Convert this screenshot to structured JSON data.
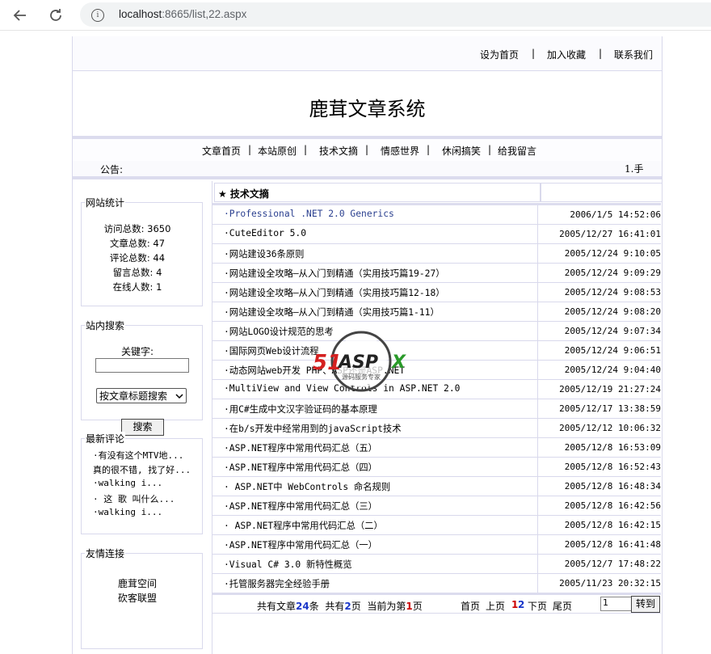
{
  "browser": {
    "url_host": "localhost",
    "url_rest": ":8665/list,22.aspx",
    "back_icon": "back-arrow-icon",
    "reload_icon": "reload-icon",
    "info_icon": "info-icon"
  },
  "toplinks": {
    "home": "设为首页",
    "fav": "加入收藏",
    "contact": "联系我们",
    "sep": "|"
  },
  "site_title": "鹿茸文章系统",
  "nav": {
    "items": [
      "文章首页",
      "本站原创",
      "技术文摘",
      "情感世界",
      "休闲搞笑",
      "给我留言"
    ],
    "sep": "|"
  },
  "notice": {
    "label": "公告:",
    "marquee": "1.手"
  },
  "sidebar": {
    "stats": {
      "title": "网站统计",
      "lines": [
        "访问总数: 3650",
        "文章总数: 47",
        "评论总数: 44",
        "留言总数: 4",
        "在线人数: 1"
      ]
    },
    "search": {
      "title": "站内搜索",
      "keyword_label": "关键字:",
      "keyword_value": "",
      "select_value": "按文章标题搜索",
      "button": "搜索"
    },
    "comments": {
      "title": "最新评论",
      "items": [
        "·有没有这个MTV地...",
        "真的很不错, 找了好...",
        "·walking i...",
        "· 这 歌 叫什么...",
        "·walking i..."
      ]
    },
    "links": {
      "title": "友情连接",
      "items": [
        "鹿茸空间",
        "砍客联盟"
      ]
    }
  },
  "content": {
    "category": "★ 技术文摘",
    "articles": [
      {
        "title": "·Professional .NET 2.0 Generics",
        "date": "2006/1/5 14:52:06"
      },
      {
        "title": "·CuteEditor 5.0",
        "date": "2005/12/27 16:41:01"
      },
      {
        "title": "·网站建设36条原则",
        "date": "2005/12/24 9:10:05"
      },
      {
        "title": "·网站建设全攻略—从入门到精通（实用技巧篇19-27）",
        "date": "2005/12/24 9:09:29"
      },
      {
        "title": "·网站建设全攻略—从入门到精通（实用技巧篇12-18）",
        "date": "2005/12/24 9:08:53"
      },
      {
        "title": "·网站建设全攻略—从入门到精通（实用技巧篇1-11）",
        "date": "2005/12/24 9:08:20"
      },
      {
        "title": "·网站LOGO设计规范的思考",
        "date": "2005/12/24 9:07:34"
      },
      {
        "title": "·国际网页Web设计流程",
        "date": "2005/12/24 9:06:51"
      },
      {
        "title": "·动态网站web开发 PHP、ASP还是ASP.NET",
        "date": "2005/12/24 9:04:40"
      },
      {
        "title": "·MultiView and View Controls in ASP.NET 2.0",
        "date": "2005/12/19 21:27:24"
      },
      {
        "title": "·用C#生成中文汉字验证码的基本原理",
        "date": "2005/12/17 13:38:59"
      },
      {
        "title": "·在b/s开发中经常用到的javaScript技术",
        "date": "2005/12/12 10:06:32"
      },
      {
        "title": "·ASP.NET程序中常用代码汇总（五）",
        "date": "2005/12/8 16:53:09"
      },
      {
        "title": "·ASP.NET程序中常用代码汇总（四）",
        "date": "2005/12/8 16:52:43"
      },
      {
        "title": "· ASP.NET中 WebControls 命名规则",
        "date": "2005/12/8 16:48:34"
      },
      {
        "title": "·ASP.NET程序中常用代码汇总（三）",
        "date": "2005/12/8 16:42:56"
      },
      {
        "title": "· ASP.NET程序中常用代码汇总（二）",
        "date": "2005/12/8 16:42:15"
      },
      {
        "title": "·ASP.NET程序中常用代码汇总（一）",
        "date": "2005/12/8 16:41:48"
      },
      {
        "title": "·Visual C# 3.0 新特性概览",
        "date": "2005/12/7 17:48:22"
      },
      {
        "title": "·托管服务器完全经验手册",
        "date": "2005/11/23 20:32:15"
      }
    ],
    "pager": {
      "total_prefix": "共有文章",
      "total": "24",
      "total_suffix": "条",
      "pages_prefix": "共有",
      "pages": "2",
      "pages_suffix": "页",
      "current_prefix": "当前为第",
      "current": "1",
      "current_suffix": "页",
      "first": "首页",
      "prev": "上页",
      "page1": "1",
      "page2": "2",
      "next": "下页",
      "last": "尾页",
      "goto_value": "1",
      "goto_button": "转到"
    }
  },
  "watermark": {
    "brand": "51ASPX",
    "tagline": "源码服务专家"
  }
}
